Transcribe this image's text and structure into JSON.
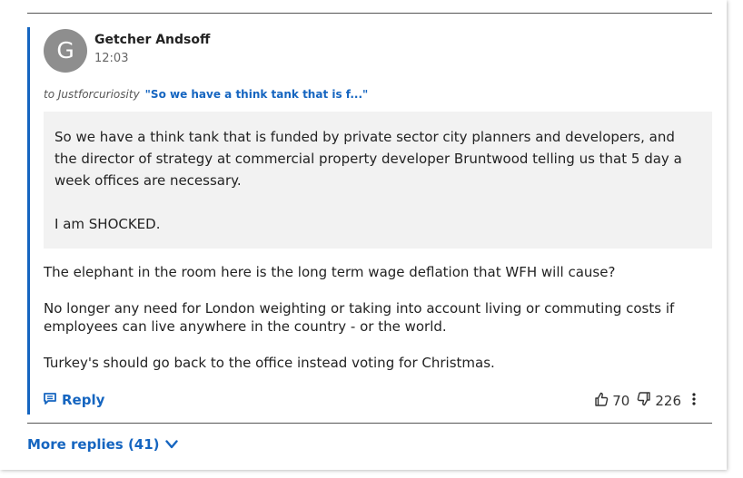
{
  "comment": {
    "avatar_initial": "G",
    "author": "Getcher Andsoff",
    "time": "12:03",
    "reply_to_prefix": "to Justforcuriosity",
    "reply_to_quote": "\"So we have a think tank that is f...\"",
    "quoted_paragraphs": [
      "So we have a think tank that is funded by private sector city planners and developers, and the director of strategy at commercial property developer Bruntwood telling us that 5 day a week offices are necessary.",
      "I am SHOCKED."
    ],
    "paragraphs": [
      "The elephant in the room here is the long term wage deflation that WFH will cause?",
      "No longer any need for London weighting or taking into account living or commuting costs if employees can live anywhere in the country - or the world.",
      "Turkey's should go back to the office instead voting for Christmas."
    ]
  },
  "actions": {
    "reply_label": "Reply",
    "likes": "70",
    "dislikes": "226"
  },
  "more_replies_label": "More replies (41)",
  "icons": {
    "reply": "speech-bubble-icon",
    "like": "thumbs-up-icon",
    "dislike": "thumbs-down-icon",
    "menu": "vertical-ellipsis-icon",
    "expand": "chevron-down-icon"
  },
  "colors": {
    "accent": "#1565c0",
    "avatar_bg": "#8e8e8e",
    "quote_bg": "#f2f2f2"
  }
}
